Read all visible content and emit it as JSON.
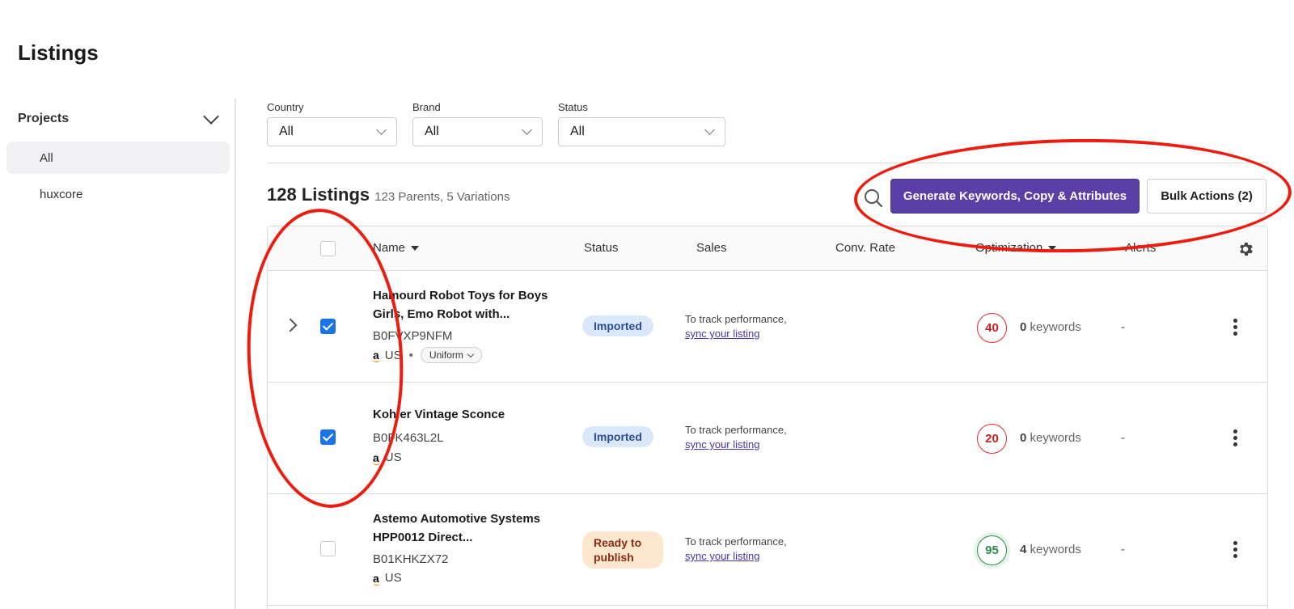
{
  "page": {
    "title": "Listings"
  },
  "sidebar": {
    "projects_label": "Projects",
    "items": [
      {
        "label": "All",
        "active": true
      },
      {
        "label": "huxcore",
        "active": false
      }
    ]
  },
  "filters": [
    {
      "label": "Country",
      "value": "All"
    },
    {
      "label": "Brand",
      "value": "All"
    },
    {
      "label": "Status",
      "value": "All"
    }
  ],
  "summary": {
    "count": "128 Listings",
    "sub": "123 Parents, 5 Variations"
  },
  "toolbar": {
    "search_icon": "search-icon",
    "generate_label": "Generate Keywords, Copy & Attributes",
    "bulk_label": "Bulk Actions (2)",
    "accent_color": "#5b3ea8"
  },
  "table": {
    "headers": {
      "name": "Name",
      "status": "Status",
      "sales": "Sales",
      "conv_rate": "Conv. Rate",
      "optimization": "Optimization",
      "alerts": "Alerts"
    },
    "rows": [
      {
        "expandable": true,
        "checked": true,
        "name": "Hamourd Robot Toys for Boys Girls, Emo Robot with...",
        "asin": "B0FVXP9NFM",
        "marketplace": "US",
        "variant": "Uniform",
        "status": "Imported",
        "track_text": "To track performance,",
        "track_link": "sync your listing",
        "score": "40",
        "keywords_count": "0",
        "keywords_label": "keywords",
        "alerts": "-"
      },
      {
        "expandable": false,
        "checked": true,
        "name": "Kohler Vintage Sconce",
        "asin": "B0FK463L2L",
        "marketplace": "US",
        "status": "Imported",
        "track_text": "To track performance,",
        "track_link": "sync your listing",
        "score": "20",
        "keywords_count": "0",
        "keywords_label": "keywords",
        "alerts": "-"
      },
      {
        "expandable": false,
        "checked": false,
        "name": "Astemo Automotive Systems HPP0012 Direct...",
        "asin": "B01KHKZX72",
        "marketplace": "US",
        "status": "Ready to publish",
        "track_text": "To track performance,",
        "track_link": "sync your listing",
        "score": "95",
        "keywords_count": "4",
        "keywords_label": "keywords",
        "alerts": "-"
      }
    ]
  },
  "colors": {
    "annotation": "#ee1c0e",
    "checkbox": "#1a73e8",
    "score_low": "#d11f1f",
    "score_high": "#2e8a4b"
  }
}
